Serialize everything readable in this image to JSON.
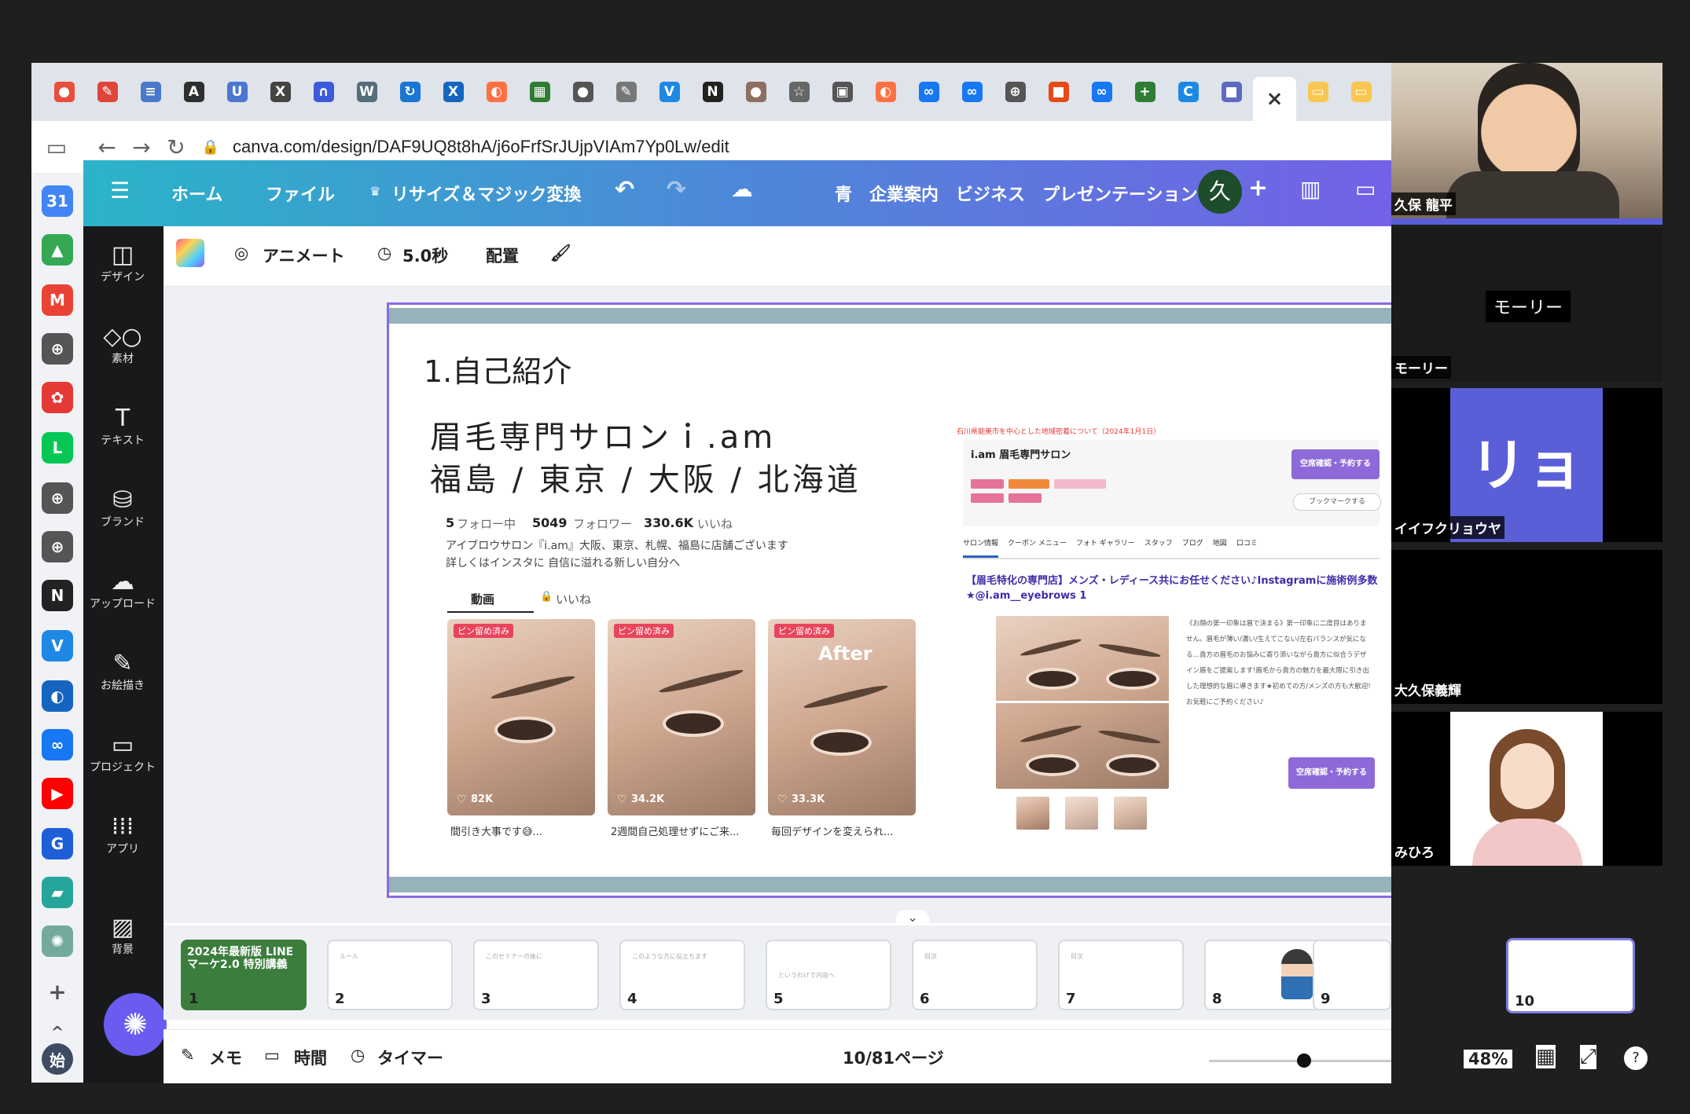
{
  "browser": {
    "url": "canva.com/design/DAF9UQ8t8hA/j6oFrfSrJUjpVIAm7Yp0Lw/edit",
    "tab_close": "×"
  },
  "canva_header": {
    "home": "ホーム",
    "file": "ファイル",
    "resize": "リサイズ＆マジック変換",
    "doc_title": "青　企業案内　ビジネス　プレゼンテーション",
    "avatar_initial": "久",
    "plus": "+"
  },
  "rail": {
    "design": "デザイン",
    "elements": "素材",
    "text": "テキスト",
    "brand": "ブランド",
    "upload": "アップロード",
    "draw": "お絵描き",
    "project": "プロジェクト",
    "apps": "アプリ",
    "background": "背景"
  },
  "toolbar": {
    "animate": "アニメート",
    "duration": "5.0秒",
    "position": "配置"
  },
  "slide": {
    "section_title": "1.自己紹介",
    "salon_name": "眉毛専門サロンｉ.am",
    "locations": "福島 / 東京 / 大阪 / 北海道",
    "ig": {
      "following_count": "5",
      "following_label": "フォロー中",
      "followers_count": "5049",
      "followers_label": "フォロワー",
      "likes_count": "330.6K",
      "likes_label": "いいね",
      "bio_line1": "アイブロウサロン『i.am』大阪、東京、札幌、福島に店舗ございます",
      "bio_line2": "詳しくはインスタに 自信に溢れる新しい自分へ",
      "tab_videos": "動画",
      "tab_likes": "いいね",
      "videos": [
        {
          "badge": "ピン留め済み",
          "likes": "82K",
          "caption": "間引き大事です😅..."
        },
        {
          "badge": "ピン留め済み",
          "likes": "34.2K",
          "caption": "2週間自己処理せずにご来..."
        },
        {
          "badge": "ピン留め済み",
          "likes": "33.3K",
          "caption": "毎回デザインを変えられ...",
          "overlay": "After"
        }
      ]
    },
    "hp": {
      "top_note": "石川県能美市を中心とした地域密着について（2024年1月1日）",
      "salon": "i.am 眉毛専門サロン",
      "reserve_btn": "空席確認・予約する",
      "bookmark": "ブックマークする",
      "tabs": [
        "サロン情報",
        "クーポン メニュー",
        "フォト ギャラリー",
        "スタッフ",
        "ブログ",
        "地図",
        "口コミ"
      ],
      "headline": "【眉毛特化の専門店】メンズ・レディース共にお任せください♪Instagramに施術例多数★@i.am__eyebrows 1",
      "body": "《お顔の第一印象は眉で決まる》第一印象に二度目はありません。眉毛が薄い/濃い/生えてこない/左右バランスが気になる…貴方の眉毛のお悩みに寄り添いながら貴方に似合うデザイン眉をご提案します!眉毛から貴方の魅力を最大限に引き出した理想的な眉に導きます★初めての方/メンズの方も大歓迎!お気軽にご予約ください♪",
      "reserve_btn2": "空席確認・予約する"
    }
  },
  "filmstrip": {
    "thumbs": [
      {
        "num": "1",
        "text": "2024年最新版 LINEマーケ2.0 特別講義"
      },
      {
        "num": "2",
        "text": "ルール"
      },
      {
        "num": "3",
        "text": "このセミナーの後に"
      },
      {
        "num": "4",
        "text": "このような方に役立ちます"
      },
      {
        "num": "5",
        "text": "というわけで内容へ"
      },
      {
        "num": "6",
        "text": "目次"
      },
      {
        "num": "7",
        "text": "目次"
      },
      {
        "num": "8",
        "text": ""
      },
      {
        "num": "9",
        "text": ""
      },
      {
        "num": "10",
        "text": ""
      }
    ]
  },
  "status": {
    "memo": "メモ",
    "time": "時間",
    "timer": "タイマー",
    "page": "10/81ページ",
    "zoom": "48%",
    "zoom_level": 0.48
  },
  "video": {
    "participants": [
      {
        "name": "久保 龍平"
      },
      {
        "name": "モーリー",
        "center_label": "モーリー"
      },
      {
        "name": "イイフクリョウヤ",
        "avatar_text": "リョ"
      },
      {
        "name": "大久保義輝"
      },
      {
        "name": "みひろ"
      }
    ]
  },
  "colors": {
    "header_gradient_start": "#2bb3c9",
    "header_gradient_end": "#7361e6",
    "selection": "#8b6ae6",
    "slide_bar": "#97b3b9",
    "avatar_bg": "#1d4d2a",
    "ryo_tile": "#5a5fd8"
  }
}
